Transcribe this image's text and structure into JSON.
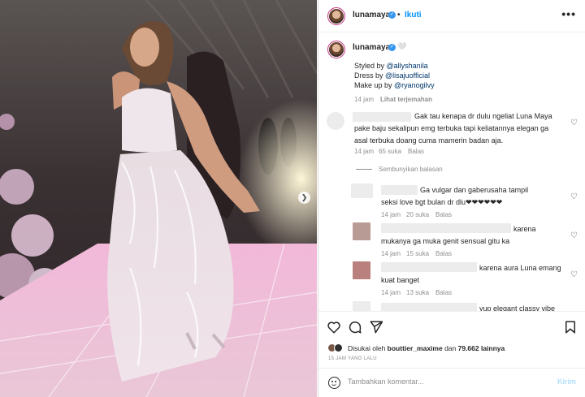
{
  "post": {
    "username": "lunamaya",
    "follow_label": "Ikuti",
    "separator": "•",
    "more_label": "•••"
  },
  "caption": {
    "username": "lunamaya",
    "emoji": "🤍",
    "lines": [
      {
        "prefix": "Styled by ",
        "mention": "@allyshanila"
      },
      {
        "prefix": "Dress by ",
        "mention": "@lisajuofficial"
      },
      {
        "prefix": "Make up by ",
        "mention": "@ryanogilvy"
      }
    ],
    "time": "14 jam",
    "translate_label": "Lihat terjemahan"
  },
  "comments": [
    {
      "lines": [
        "Gak tau kenapa dr dulu ngeliat Luna Maya",
        "pake baju sekalipun emg terbuka tapi keliatannya elegan ga",
        "asal terbuka doang cuma mamerin badan aja."
      ],
      "time": "14 jam",
      "likes": "65 suka",
      "reply_label": "Balas"
    }
  ],
  "hide_replies_label": "Sembunyikan balasan",
  "replies": [
    {
      "lines": [
        "Ga vulgar dan gaberusaha tampil",
        "seksi love bgt bulan dr dlu❤❤❤❤❤❤"
      ],
      "time": "14 jam",
      "likes": "20 suka",
      "reply_label": "Balas"
    },
    {
      "lines": [
        "karena",
        "mukanya ga muka genit sensual gitu ka"
      ],
      "time": "14 jam",
      "likes": "15 suka",
      "reply_label": "Balas"
    },
    {
      "lines": [
        "karena aura Luna emang",
        "kuat banget"
      ],
      "time": "14 jam",
      "likes": "13 suka",
      "reply_label": "Balas"
    },
    {
      "lines": [
        "yup elegant classy vibe"
      ],
      "time": "",
      "likes": "",
      "reply_label": ""
    }
  ],
  "likes_line": {
    "prefix": "Disukai oleh ",
    "user": "bouttier_maxime",
    "middle": " dan ",
    "count": "79.662 lainnya"
  },
  "time_ago": "15 JAM YANG LALU",
  "comment_box": {
    "placeholder": "Tambahkan komentar...",
    "post_label": "Kirim"
  },
  "icons": {
    "heart": "heart-icon",
    "comment": "comment-icon",
    "share": "share-icon",
    "save": "bookmark-icon",
    "emoji": "emoji-icon",
    "next": "chevron-right-icon"
  },
  "colors": {
    "link": "#00376b",
    "follow": "#0095f6",
    "verified": "#3897f0",
    "muted": "#8e8e8e"
  }
}
